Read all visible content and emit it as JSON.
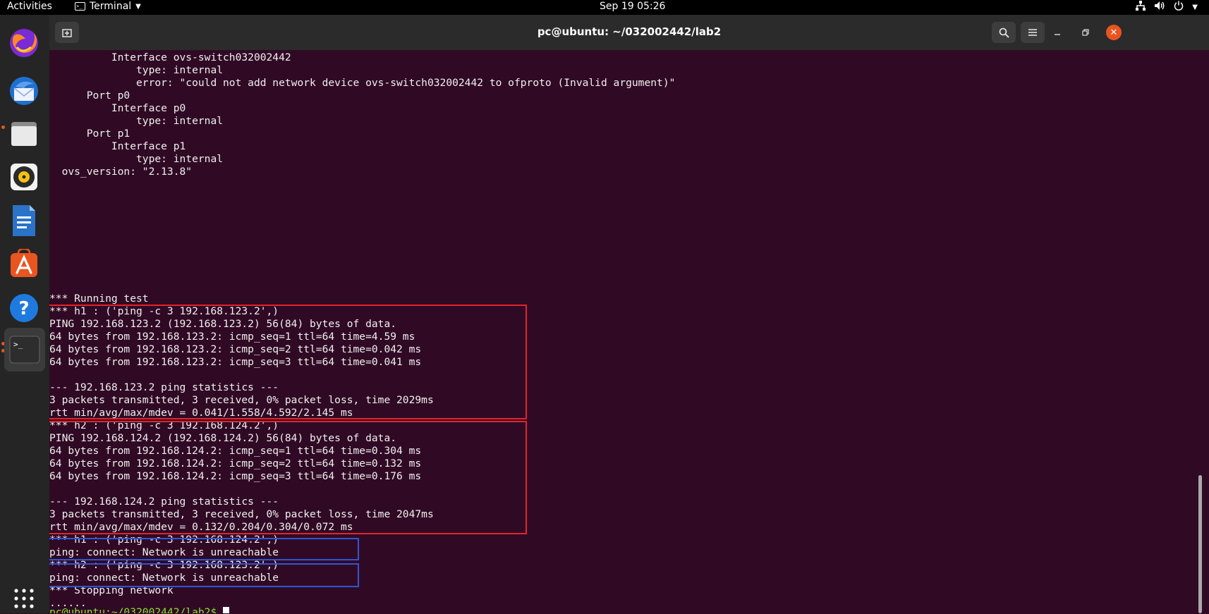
{
  "topbar": {
    "activities": "Activities",
    "app_name": "Terminal",
    "clock": "Sep 19  05:26",
    "tray_icons": [
      "network-icon",
      "volume-icon",
      "power-icon",
      "chevron-down-icon"
    ]
  },
  "dock": {
    "items": [
      "firefox-icon",
      "thunderbird-icon",
      "files-icon",
      "rhythmbox-icon",
      "writer-icon",
      "software-icon",
      "help-icon",
      "terminal-icon",
      "app-grid-icon"
    ]
  },
  "window": {
    "title": "pc@ubuntu: ~/032002442/lab2"
  },
  "terminal": {
    "lines": [
      "          Interface ovs-switch032002442",
      "              type: internal",
      "              error: \"could not add network device ovs-switch032002442 to ofproto (Invalid argument)\"",
      "      Port p0",
      "          Interface p0",
      "              type: internal",
      "      Port p1",
      "          Interface p1",
      "              type: internal",
      "  ovs_version: \"2.13.8\"",
      "",
      "",
      "",
      "",
      "",
      "",
      "",
      "",
      "",
      "*** Running test",
      "*** h1 : ('ping -c 3 192.168.123.2',)",
      "PING 192.168.123.2 (192.168.123.2) 56(84) bytes of data.",
      "64 bytes from 192.168.123.2: icmp_seq=1 ttl=64 time=4.59 ms",
      "64 bytes from 192.168.123.2: icmp_seq=2 ttl=64 time=0.042 ms",
      "64 bytes from 192.168.123.2: icmp_seq=3 ttl=64 time=0.041 ms",
      "",
      "--- 192.168.123.2 ping statistics ---",
      "3 packets transmitted, 3 received, 0% packet loss, time 2029ms",
      "rtt min/avg/max/mdev = 0.041/1.558/4.592/2.145 ms",
      "*** h2 : ('ping -c 3 192.168.124.2',)",
      "PING 192.168.124.2 (192.168.124.2) 56(84) bytes of data.",
      "64 bytes from 192.168.124.2: icmp_seq=1 ttl=64 time=0.304 ms",
      "64 bytes from 192.168.124.2: icmp_seq=2 ttl=64 time=0.132 ms",
      "64 bytes from 192.168.124.2: icmp_seq=3 ttl=64 time=0.176 ms",
      "",
      "--- 192.168.124.2 ping statistics ---",
      "3 packets transmitted, 3 received, 0% packet loss, time 2047ms",
      "rtt min/avg/max/mdev = 0.132/0.204/0.304/0.072 ms",
      "*** h1 : ('ping -c 3 192.168.124.2',)",
      "ping: connect: Network is unreachable",
      "*** h2 : ('ping -c 3 192.168.123.2',)",
      "ping: connect: Network is unreachable",
      "*** Stopping network",
      "......"
    ],
    "prompt": "pc@ubuntu:~/032002442/lab2$ "
  },
  "colors": {
    "terminal_bg": "#300a24",
    "annotation_red": "#e3242b",
    "annotation_blue": "#2f55d4",
    "accent": "#e95420"
  }
}
